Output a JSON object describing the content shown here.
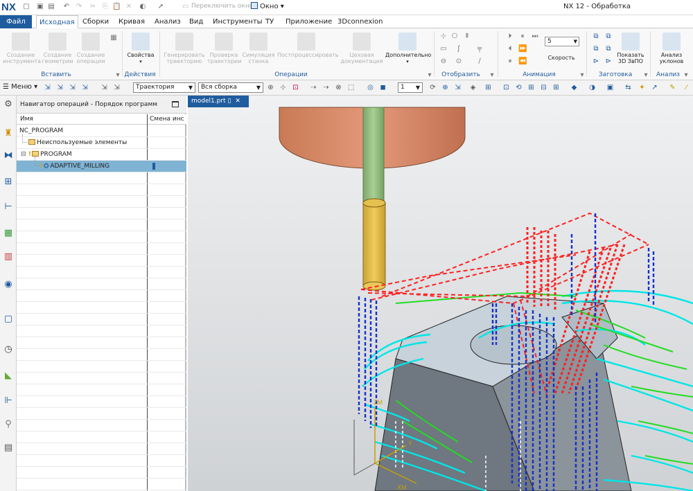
{
  "titlebar": {
    "logo": "NX",
    "switch_window": "Переключить окно",
    "window_menu": "Окно ▾",
    "title": "NX 12 - Обработка"
  },
  "ribbon_tabs": [
    "Файл",
    "Исходная",
    "Сборки",
    "Кривая",
    "Анализ",
    "Вид",
    "Инструменты",
    "ТУ",
    "Приложение",
    "3Dconnexion"
  ],
  "ribbon": {
    "create_tool": "Создание инструмента",
    "create_geometry": "Создание геометрии",
    "create_operation": "Создание операции",
    "properties": "Свойства",
    "generate_path": "Генерировать траекторию",
    "verify_path": "Проверка траектории",
    "simulate_machine": "Симуляция станка",
    "postprocess": "Постпроцессировать",
    "shop_doc": "Цеховая документация",
    "more": "Дополнительно",
    "speed_value": "5",
    "speed_label": "Скорость",
    "show_3d": "Показать 3D ЗвПО",
    "slope_analysis": "Анализ уклонов",
    "groups": {
      "insert": "Вставить",
      "actions": "Действия",
      "operations": "Операции",
      "display": "Отобразить",
      "animation": "Анимация",
      "workpiece": "Заготовка",
      "analysis": "Анализ"
    }
  },
  "toolbar2": {
    "menu": "Меню",
    "filter_value": "Траектория",
    "scope_value": "Вся сборка",
    "count_value": "1"
  },
  "navigator": {
    "title": "Навигатор операций - Порядок программ",
    "col_name": "Имя",
    "col_toolchange": "Смена инс",
    "rows": [
      {
        "name": "NC_PROGRAM"
      },
      {
        "name": "Неиспользуемые элементы"
      },
      {
        "name": "PROGRAM"
      },
      {
        "name": "ADAPTIVE_MILLING"
      }
    ]
  },
  "viewport": {
    "tab_label": "model1.prt",
    "axis_zm": "ZM",
    "axis_xm": "XM",
    "axis_y": "Y"
  }
}
